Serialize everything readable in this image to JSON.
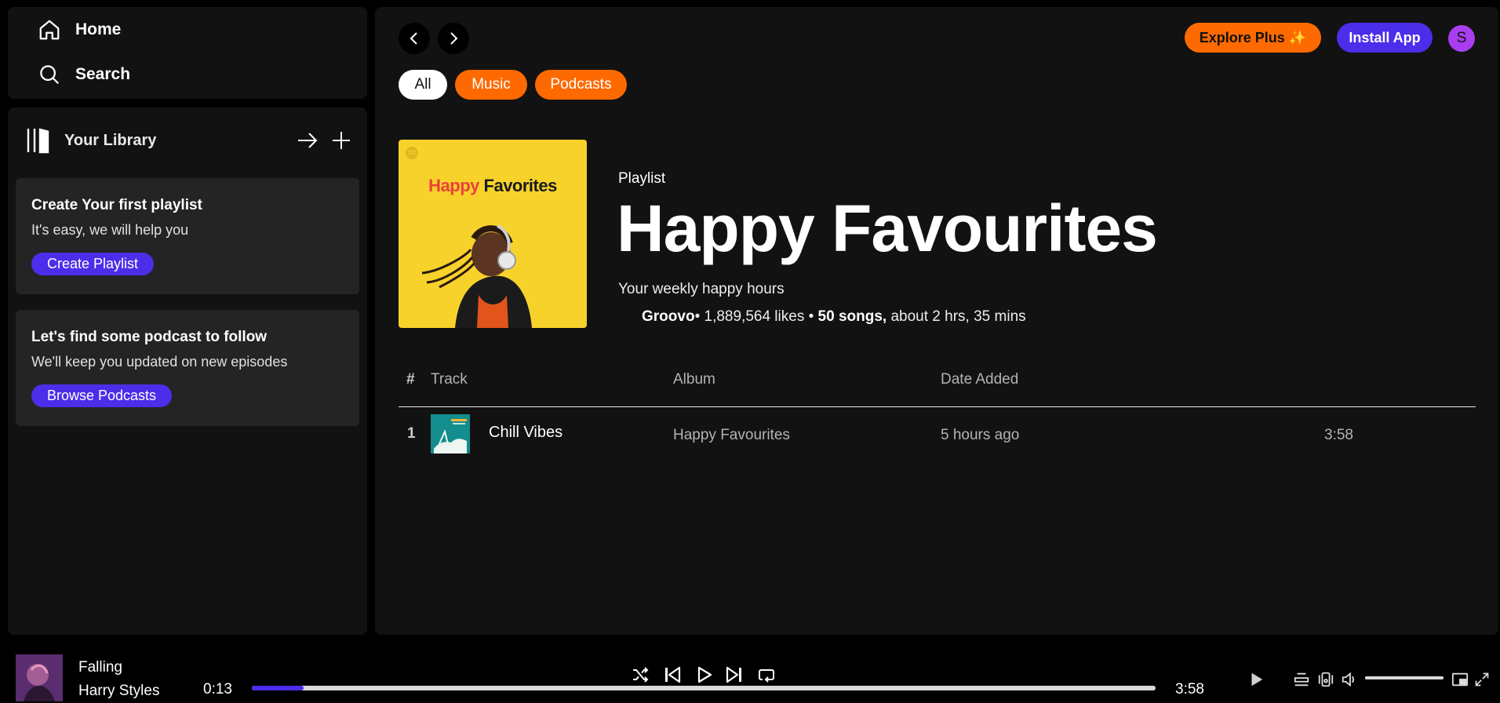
{
  "nav": {
    "home": "Home",
    "search": "Search"
  },
  "library": {
    "title": "Your Library",
    "cards": [
      {
        "title": "Create Your first playlist",
        "text": "It's easy, we will help you",
        "button": "Create Playlist"
      },
      {
        "title": "Let's find some podcast to follow",
        "text": "We'll keep you updated on new episodes",
        "button": "Browse Podcasts"
      }
    ]
  },
  "header": {
    "explore": "Explore Plus ✨",
    "install": "Install App",
    "avatar": "S",
    "chips": [
      "All",
      "Music",
      "Podcasts"
    ]
  },
  "playlist": {
    "cover_title_a": "Happy ",
    "cover_title_b": "Favorites",
    "type": "Playlist",
    "title": "Happy Favourites",
    "description": "Your weekly happy hours",
    "owner": "Groovo",
    "likes": "1,889,564 likes",
    "songs": "50 songs,",
    "duration": "about 2 hrs, 35 mins"
  },
  "table": {
    "headers": {
      "num": "#",
      "track": "Track",
      "album": "Album",
      "date": "Date Added"
    },
    "rows": [
      {
        "num": "1",
        "track": "Chill Vibes",
        "album": "Happy Favourites",
        "date": "5 hours ago",
        "duration": "3:58"
      }
    ]
  },
  "player": {
    "title": "Falling",
    "artist": "Harry Styles",
    "elapsed": "0:13",
    "total": "3:58",
    "progress": 0.057,
    "volume": 1.0
  },
  "colors": {
    "accent_orange": "#ff6a00",
    "accent_purple": "#4b2eea",
    "avatar": "#a83ef0",
    "cover_yellow": "#f7d22b",
    "cover_red": "#e9413b"
  }
}
